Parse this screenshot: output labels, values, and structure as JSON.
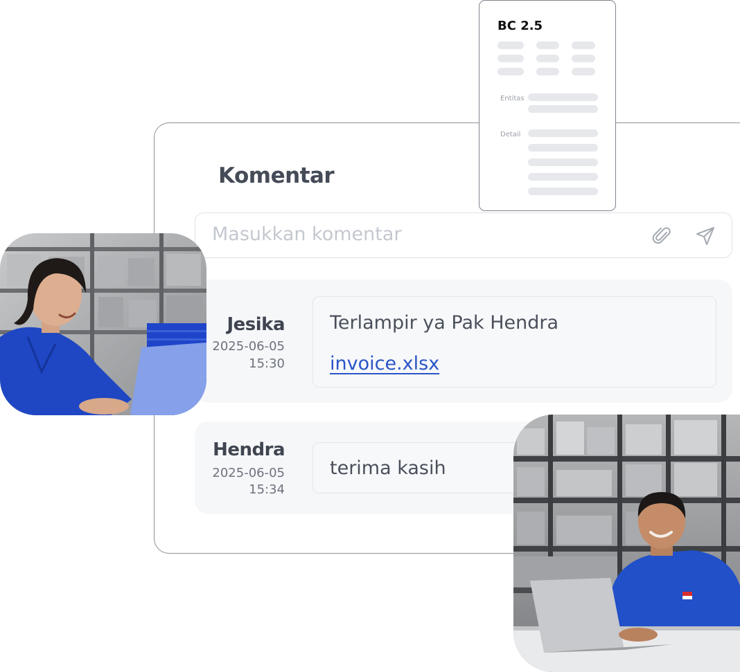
{
  "panel": {
    "title": "Komentar",
    "input_placeholder": "Masukkan komentar",
    "attach_icon": "paperclip-icon",
    "send_icon": "send-icon"
  },
  "comments": [
    {
      "author": "Jesika",
      "date": "2025-06-05",
      "time": "15:30",
      "text": "Terlampir ya Pak Hendra",
      "attachment": "invoice.xlsx"
    },
    {
      "author": "Hendra",
      "date": "2025-06-05",
      "time": "15:34",
      "text": "terima kasih"
    }
  ],
  "document": {
    "title": "BC 2.5",
    "entity_label": "Entitas",
    "detail_label": "Detail"
  },
  "colors": {
    "accent_link": "#2a55c8",
    "uniform_blue": "#1f47c4",
    "card_border": "#8c9099",
    "comment_bg": "#f6f7f9"
  }
}
